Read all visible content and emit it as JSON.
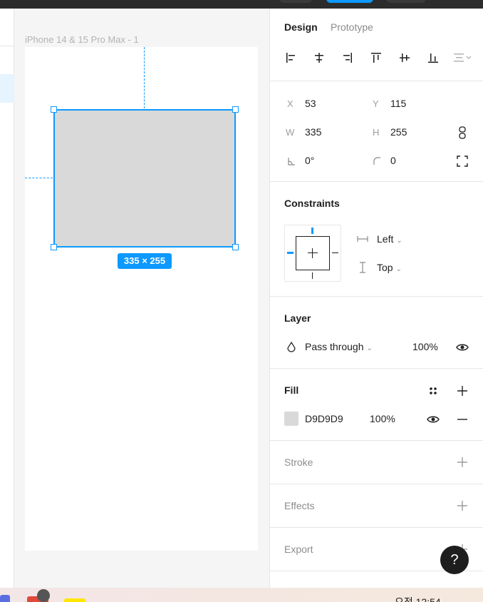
{
  "canvas": {
    "frame_label": "iPhone 14 & 15 Pro Max - 1",
    "size_badge": "335 × 255",
    "selection_color": "#0d99ff",
    "rect_fill": "#D9D9D9"
  },
  "panel": {
    "tabs": [
      {
        "label": "Design",
        "active": true
      },
      {
        "label": "Prototype",
        "active": false
      }
    ],
    "alignment_icons": [
      "align-left-icon",
      "align-horizontal-center-icon",
      "align-right-icon",
      "align-top-icon",
      "align-vertical-center-icon",
      "align-bottom-icon",
      "distribute-icon"
    ],
    "dimensions": {
      "x_label": "X",
      "x": "53",
      "y_label": "Y",
      "y": "115",
      "w_label": "W",
      "w": "335",
      "h_label": "H",
      "h": "255",
      "rotation": "0°",
      "radius": "0"
    },
    "constraints": {
      "title": "Constraints",
      "horizontal": "Left",
      "vertical": "Top"
    },
    "layer": {
      "title": "Layer",
      "blend": "Pass through",
      "opacity": "100%"
    },
    "fill": {
      "title": "Fill",
      "hex": "D9D9D9",
      "opacity": "100%",
      "swatch": "#D9D9D9"
    },
    "stroke": {
      "title": "Stroke"
    },
    "effects": {
      "title": "Effects"
    },
    "export": {
      "title": "Export"
    }
  },
  "help": {
    "label": "?"
  },
  "taskbar": {
    "clock": "오전 12:54"
  }
}
